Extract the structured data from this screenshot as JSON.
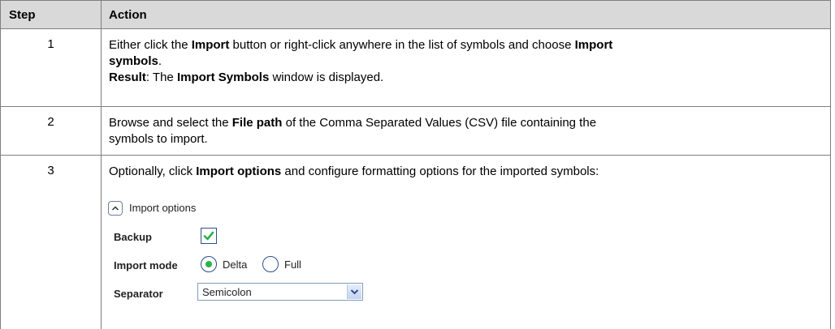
{
  "table": {
    "headers": {
      "step": "Step",
      "action": "Action"
    },
    "rows": [
      {
        "step": "1",
        "line1_pre": "Either click the ",
        "line1_bold1": "Import",
        "line1_mid": " button or right-click anywhere in the list of symbols and choose ",
        "line1_bold2": "Import",
        "line2_bold": "symbols",
        "line2_post": ".",
        "line3_bold1": "Result",
        "line3_mid": ": The ",
        "line3_bold2": "Import Symbols",
        "line3_post": " window is displayed."
      },
      {
        "step": "2",
        "line1_pre": "Browse and select the ",
        "line1_bold": "File path",
        "line1_post": " of the Comma Separated Values (CSV) file containing the",
        "line2": "symbols to import."
      },
      {
        "step": "3",
        "line1_pre": "Optionally, click ",
        "line1_bold": "Import options",
        "line1_post": " and configure formatting options for the imported symbols:"
      }
    ]
  },
  "import_options": {
    "toggle_label": "Import options",
    "backup_label": "Backup",
    "backup_checked": true,
    "import_mode_label": "Import mode",
    "mode_delta": "Delta",
    "mode_full": "Full",
    "selected_mode": "Delta",
    "separator_label": "Separator",
    "separator_value": "Semicolon"
  },
  "colors": {
    "header_bg": "#d9d9d9",
    "border": "#7f7f7f",
    "check_green": "#2db24c",
    "control_border": "#2e4f8c"
  },
  "icons": [
    "chevron-up-icon",
    "checkmark-icon",
    "chevron-down-icon"
  ]
}
